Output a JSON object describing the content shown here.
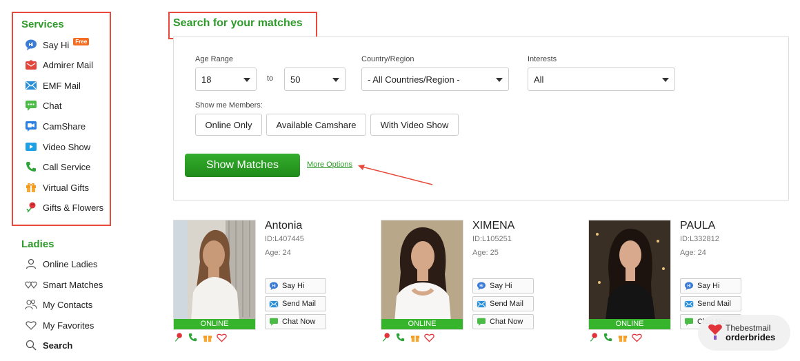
{
  "sidebar": {
    "services_title": "Services",
    "services": [
      {
        "label": "Say Hi",
        "icon": "say-hi-icon",
        "badge": "Free"
      },
      {
        "label": "Admirer Mail",
        "icon": "admirer-mail-icon"
      },
      {
        "label": "EMF Mail",
        "icon": "emf-mail-icon"
      },
      {
        "label": "Chat",
        "icon": "chat-icon"
      },
      {
        "label": "CamShare",
        "icon": "camshare-icon"
      },
      {
        "label": "Video Show",
        "icon": "video-show-icon"
      },
      {
        "label": "Call Service",
        "icon": "phone-icon"
      },
      {
        "label": "Virtual Gifts",
        "icon": "gift-icon"
      },
      {
        "label": "Gifts & Flowers",
        "icon": "flower-icon"
      }
    ],
    "ladies_title": "Ladies",
    "ladies": [
      {
        "label": "Online Ladies",
        "icon": "person-icon"
      },
      {
        "label": "Smart Matches",
        "icon": "hearts-icon"
      },
      {
        "label": "My Contacts",
        "icon": "contacts-icon"
      },
      {
        "label": "My Favorites",
        "icon": "heart-icon"
      },
      {
        "label": "Search",
        "icon": "search-icon"
      }
    ]
  },
  "search": {
    "title": "Search for your matches",
    "age_range_label": "Age Range",
    "age_from": "18",
    "to_label": "to",
    "age_to": "50",
    "country_label": "Country/Region",
    "country_value": "- All Countries/Region -",
    "interests_label": "Interests",
    "interests_value": "All",
    "show_members_label": "Show me Members:",
    "member_options": [
      "Online Only",
      "Available Camshare",
      "With Video Show"
    ],
    "show_matches_label": "Show Matches",
    "more_options_label": "More Options"
  },
  "profiles": [
    {
      "name": "Antonia",
      "id": "ID:L407445",
      "age": "Age: 24",
      "status": "ONLINE"
    },
    {
      "name": "XIMENA",
      "id": "ID:L105251",
      "age": "Age: 25",
      "status": "ONLINE"
    },
    {
      "name": "PAULA",
      "id": "ID:L332812",
      "age": "Age: 24",
      "status": "ONLINE"
    }
  ],
  "actions": {
    "say_hi": "Say Hi",
    "send_mail": "Send Mail",
    "chat_now": "Chat Now"
  },
  "watermark": {
    "line1": "Thebestmail",
    "line2": "orderbrides"
  },
  "colors": {
    "accent_green": "#2e9a2a",
    "highlight_red": "#e8493a",
    "online_green": "#36b52c"
  }
}
